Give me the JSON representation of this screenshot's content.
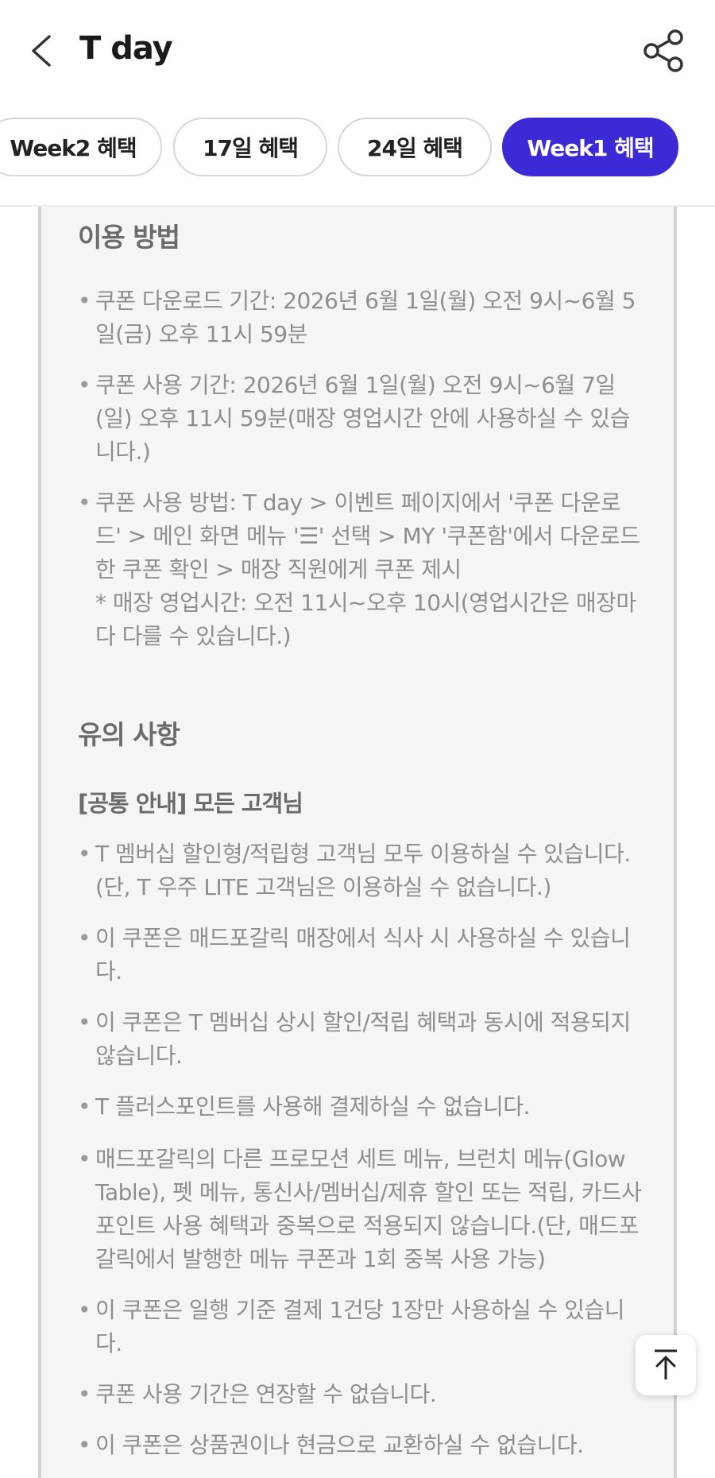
{
  "header": {
    "title": "T day"
  },
  "tabs": [
    {
      "label": "Week2 혜택"
    },
    {
      "label": "17일 혜택"
    },
    {
      "label": "24일 혜택"
    },
    {
      "label": "Week1 혜택"
    }
  ],
  "usage": {
    "heading": "이용 방법",
    "items": [
      "쿠폰 다운로드 기간: 2026년 6월 1일(월) 오전 9시~6월 5일(금) 오후 11시 59분",
      "쿠폰 사용 기간: 2026년 6월 1일(월) 오전 9시~6월 7일(일) 오후 11시 59분(매장 영업시간 안에 사용하실 수 있습니다.)",
      "쿠폰 사용 방법: T day > 이벤트 페이지에서 '쿠폰 다운로드' > 메인 화면 메뉴 '☰' 선택 > MY '쿠폰함'에서 다운로드한 쿠폰 확인 > 매장 직원에게 쿠폰 제시\n* 매장 영업시간: 오전 11시~오후 10시(영업시간은 매장마다 다를 수 있습니다.)"
    ]
  },
  "notice": {
    "heading": "유의 사항",
    "subheading": "[공통 안내] 모든 고객님",
    "items": [
      "T 멤버십 할인형/적립형 고객님 모두 이용하실 수 있습니다.(단, T 우주 LITE 고객님은 이용하실 수 없습니다.)",
      "이 쿠폰은 매드포갈릭 매장에서 식사 시 사용하실 수 있습니다.",
      "이 쿠폰은 T 멤버십 상시 할인/적립 혜택과 동시에 적용되지 않습니다.",
      "T 플러스포인트를 사용해 결제하실 수 없습니다.",
      "매드포갈릭의 다른 프로모션 세트 메뉴, 브런치 메뉴(Glow Table), 펫 메뉴, 통신사/멤버십/제휴 할인 또는 적립, 카드사 포인트 사용 혜택과 중복으로 적용되지 않습니다.(단, 매드포갈릭에서 발행한 메뉴 쿠폰과 1회 중복 사용 가능)",
      "이 쿠폰은 일행 기준 결제 1건당 1장만 사용하실 수 있습니다.",
      "쿠폰 사용 기간은 연장할 수 없습니다.",
      "이 쿠폰은 상품권이나 현금으로 교환하실 수 없습니다."
    ]
  },
  "icons": {
    "back": "back-arrow-icon",
    "share": "share-icon",
    "top": "scroll-to-top-icon"
  },
  "colors": {
    "accent": "#3b2ad6",
    "muted_text": "#8e8e8e",
    "heading_text": "#6b6b6b"
  }
}
